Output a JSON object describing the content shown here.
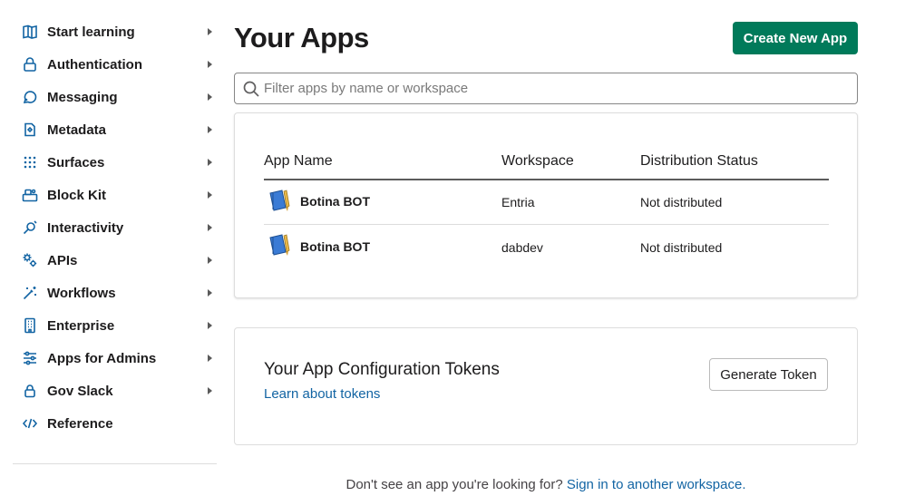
{
  "sidebar": {
    "items": [
      {
        "label": "Start learning",
        "icon": "book-icon",
        "chevron": true
      },
      {
        "label": "Authentication",
        "icon": "lock-icon",
        "chevron": true
      },
      {
        "label": "Messaging",
        "icon": "messaging-icon",
        "chevron": true
      },
      {
        "label": "Metadata",
        "icon": "metadata-icon",
        "chevron": true
      },
      {
        "label": "Surfaces",
        "icon": "grid-dots-icon",
        "chevron": true
      },
      {
        "label": "Block Kit",
        "icon": "blocks-icon",
        "chevron": true
      },
      {
        "label": "Interactivity",
        "icon": "interactivity-icon",
        "chevron": true
      },
      {
        "label": "APIs",
        "icon": "gears-icon",
        "chevron": true
      },
      {
        "label": "Workflows",
        "icon": "magic-wand-icon",
        "chevron": true
      },
      {
        "label": "Enterprise",
        "icon": "building-icon",
        "chevron": true
      },
      {
        "label": "Apps for Admins",
        "icon": "sliders-icon",
        "chevron": true
      },
      {
        "label": "Gov Slack",
        "icon": "lock-icon",
        "chevron": true
      },
      {
        "label": "Reference",
        "icon": "code-icon",
        "chevron": false
      }
    ]
  },
  "header": {
    "title": "Your Apps",
    "create_button": "Create New App"
  },
  "search": {
    "placeholder": "Filter apps by name or workspace",
    "value": ""
  },
  "apps_table": {
    "columns": [
      "App Name",
      "Workspace",
      "Distribution Status"
    ],
    "rows": [
      {
        "app_name": "Botina BOT",
        "workspace": "Entria",
        "status": "Not distributed"
      },
      {
        "app_name": "Botina BOT",
        "workspace": "dabdev",
        "status": "Not distributed"
      }
    ]
  },
  "tokens": {
    "title": "Your App Configuration Tokens",
    "link": "Learn about tokens",
    "button": "Generate Token"
  },
  "footer": {
    "text": "Don't see an app you're looking for?",
    "link": "Sign in to another workspace."
  },
  "colors": {
    "brand_green": "#007a5a",
    "link_blue": "#1264a3",
    "text": "#1d1c1d"
  }
}
